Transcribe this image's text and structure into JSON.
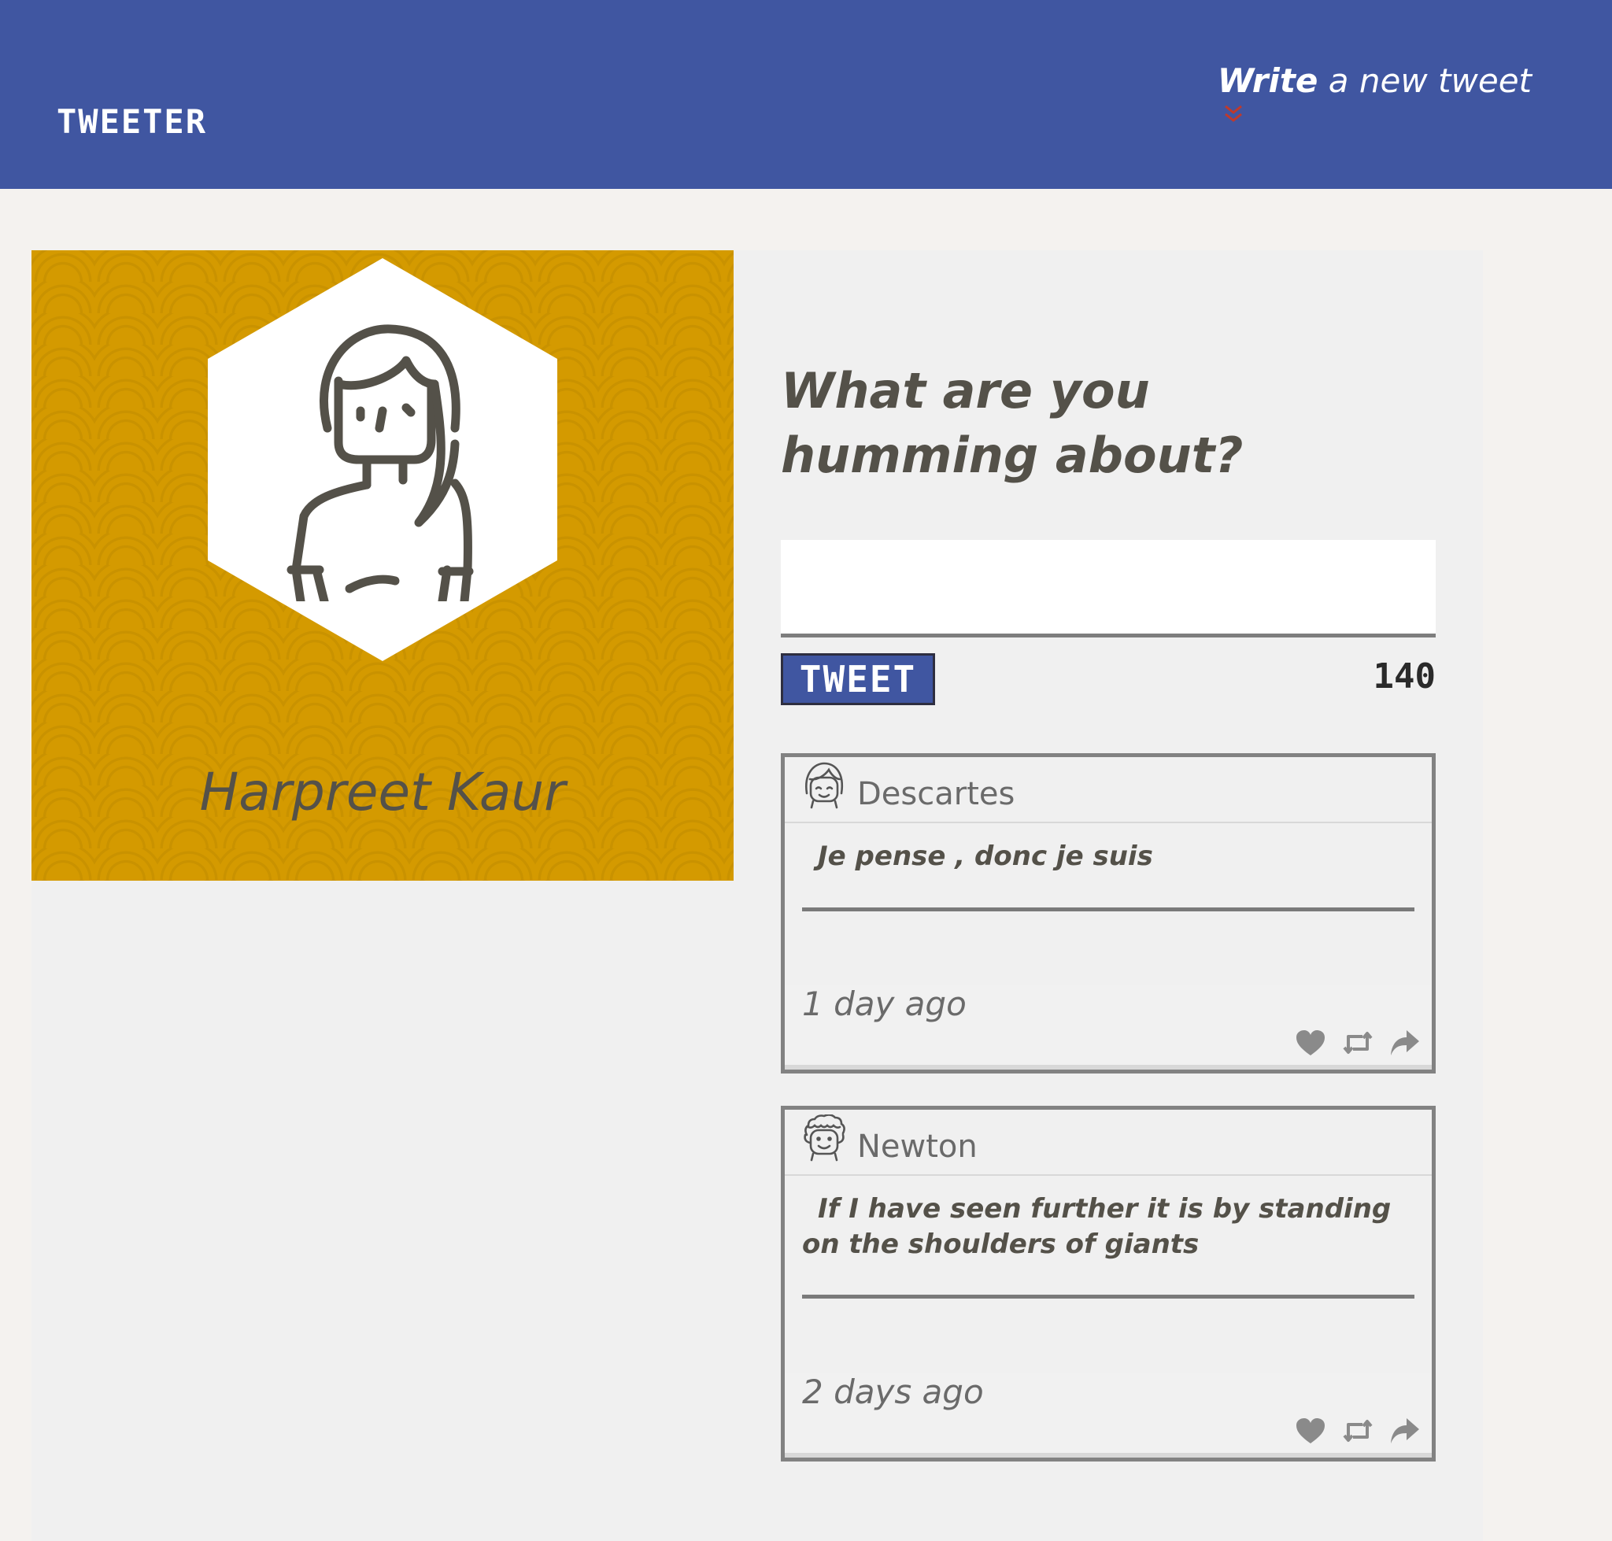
{
  "header": {
    "brand": "TWEETER",
    "compose_strong": "Write",
    "compose_rest": "a new tweet",
    "chevron_color": "#c0392b",
    "background": "#4056a1"
  },
  "profile": {
    "name": "Harpreet Kaur",
    "background": "#d49a00"
  },
  "composer": {
    "question": "What are you humming about?",
    "input_value": "",
    "input_placeholder": "",
    "button_label": "TWEET",
    "counter": "140"
  },
  "tweets": [
    {
      "author": "Descartes",
      "text": "Je pense , donc je suis",
      "time": "1 day ago"
    },
    {
      "author": "Newton",
      "text": "If I have seen further it is by standing on the shoulders of giants",
      "time": "2 days ago"
    }
  ],
  "icons": {
    "like": "heart-icon",
    "retweet": "retweet-icon",
    "share": "share-icon",
    "compose_indicator": "double-chevron-down-icon"
  }
}
